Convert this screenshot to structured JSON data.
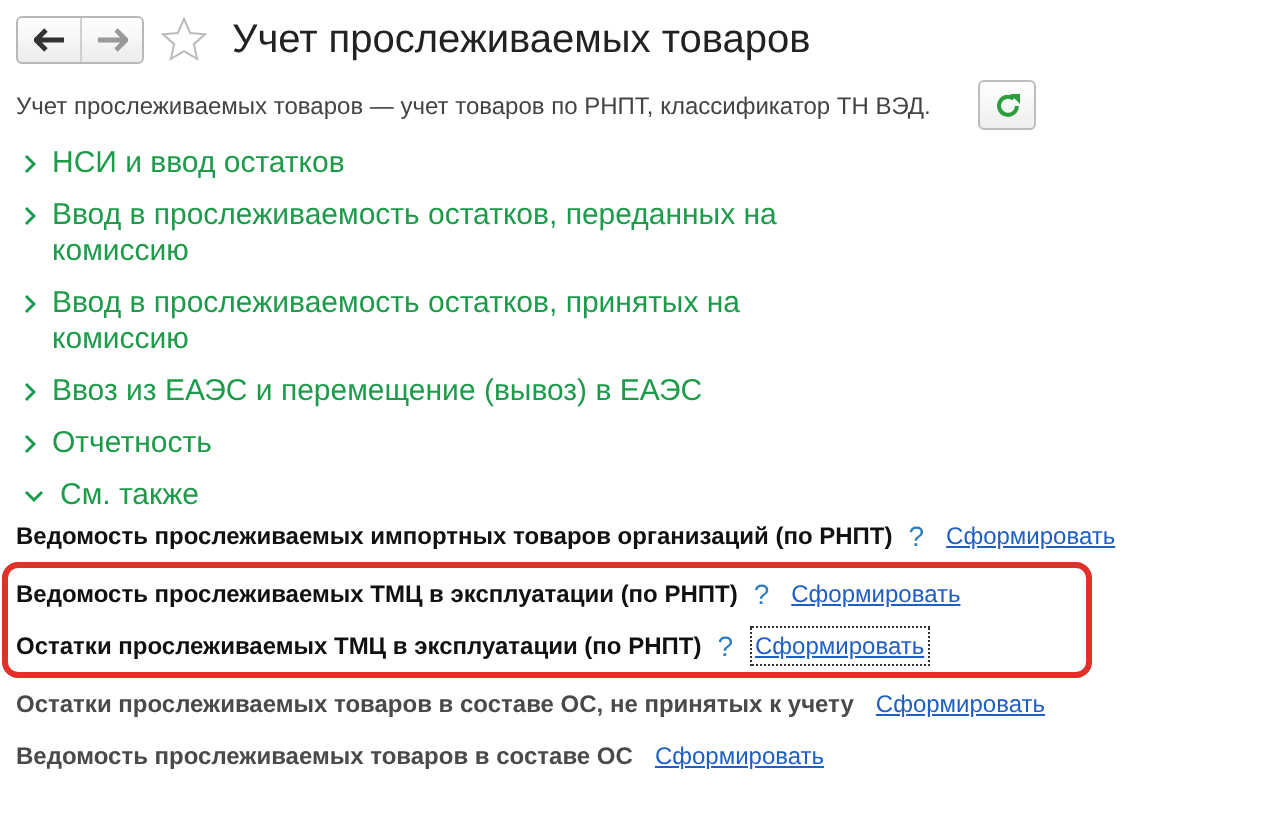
{
  "window": {
    "title": "Учет прослеживаемых товаров",
    "favorite": false
  },
  "description": "Учет прослеживаемых товаров — учет товаров по РНПТ, классификатор ТН ВЭД.",
  "sections": [
    {
      "label": "НСИ и ввод остатков",
      "expanded": false
    },
    {
      "label": "Ввод в прослеживаемость остатков, переданных на комиссию",
      "expanded": false
    },
    {
      "label": "Ввод в прослеживаемость остатков, принятых на комиссию",
      "expanded": false
    },
    {
      "label": "Ввоз из ЕАЭС и перемещение (вывоз) в ЕАЭС",
      "expanded": false
    },
    {
      "label": "Отчетность",
      "expanded": false
    },
    {
      "label": "См. также",
      "expanded": true
    }
  ],
  "reports": [
    {
      "title": "Ведомость прослеживаемых импортных товаров организаций (по РНПТ)",
      "help": "?",
      "link": "Сформировать",
      "muted": false,
      "highlighted": false,
      "focused": false
    },
    {
      "title": "Ведомость прослеживаемых ТМЦ в эксплуатации (по РНПТ)",
      "help": "?",
      "link": "Сформировать",
      "muted": false,
      "highlighted": true,
      "focused": false
    },
    {
      "title": "Остатки прослеживаемых ТМЦ в эксплуатации (по РНПТ)",
      "help": "?",
      "link": "Сформировать",
      "muted": false,
      "highlighted": true,
      "focused": true
    },
    {
      "title": "Остатки прослеживаемых товаров в составе ОС, не принятых к учету",
      "link": "Сформировать",
      "muted": true,
      "highlighted": false,
      "focused": false
    },
    {
      "title": "Ведомость прослеживаемых товаров в составе ОС",
      "link": "Сформировать",
      "muted": true,
      "highlighted": false,
      "focused": false
    }
  ]
}
